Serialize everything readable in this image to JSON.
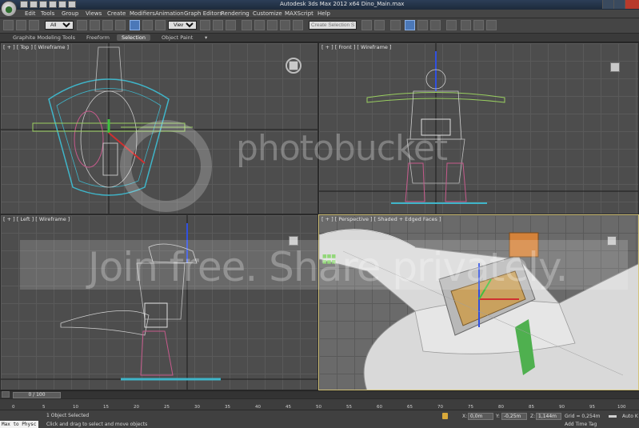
{
  "titlebar": {
    "title": "Autodesk 3ds Max  2012 x64     Dino_Main.max"
  },
  "menu": {
    "items": [
      "Edit",
      "Tools",
      "Group",
      "Views",
      "Create",
      "Modifiers",
      "Animation",
      "Graph Editors",
      "Rendering",
      "Customize",
      "MAXScript",
      "Help"
    ]
  },
  "toolbar": {
    "filter_value": "All",
    "refcoord_value": "View",
    "selection_set_placeholder": "Create Selection S"
  },
  "ribbon": {
    "tabs": [
      "Graphite Modeling Tools",
      "Freeform",
      "Selection",
      "Object Paint"
    ]
  },
  "viewports": {
    "top": {
      "label": "[ + ] [ Top ] [ Wireframe ]"
    },
    "front": {
      "label": "[ + ] [ Front ] [ Wireframe ]"
    },
    "left": {
      "label": "[ + ] [ Left ] [ Wireframe ]"
    },
    "perspective": {
      "label": "[ + ] [ Perspective ] [ Shaded + Edged Faces ]"
    }
  },
  "watermark": {
    "brand": "photobucket",
    "slogan": "Join free. Share privately."
  },
  "timeline": {
    "frame_display": "0 / 100",
    "ticks": [
      "0",
      "5",
      "10",
      "15",
      "20",
      "25",
      "30",
      "35",
      "40",
      "45",
      "50",
      "55",
      "60",
      "65",
      "70",
      "75",
      "80",
      "85",
      "90",
      "95",
      "100"
    ]
  },
  "status": {
    "maxscript": "Max to Physc",
    "selected": "1 Object Selected",
    "prompt": "Click and drag to select and move objects",
    "x_label": "X:",
    "x_value": "0,0m",
    "y_label": "Y:",
    "y_value": "-0,25m",
    "z_label": "Z:",
    "z_value": "1,144m",
    "grid": "Grid = 0,254m",
    "auto_key": "Auto K",
    "add_time_tag": "Add Time Tag"
  }
}
